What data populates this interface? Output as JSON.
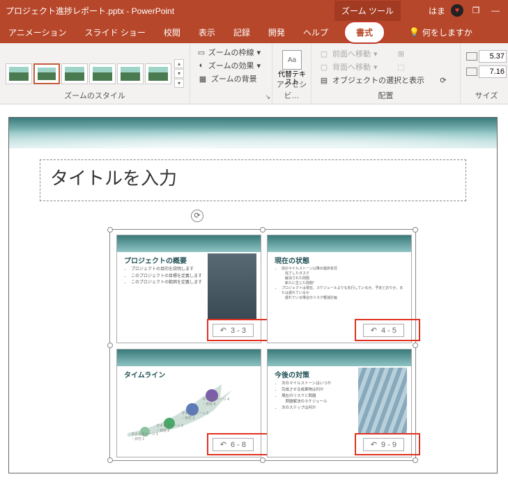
{
  "titlebar": {
    "document": "プロジェクト進捗レポート.pptx  -  PowerPoint",
    "tool_context": "ズーム ツール",
    "user": "はま",
    "maximize": "❐",
    "minimize": "—"
  },
  "tabs": {
    "animation": "アニメーション",
    "slideshow": "スライド ショー",
    "review": "校閲",
    "view": "表示",
    "record": "記録",
    "developer": "開発",
    "help": "ヘルプ",
    "format": "書式",
    "tellme": "何をしますか"
  },
  "ribbon": {
    "zoom_style": "ズームのスタイル",
    "zoom_border": "ズームの枠線",
    "zoom_effect": "ズームの効果",
    "zoom_bg": "ズームの背景",
    "alt_text": "代替テキスト",
    "access": "アクセシビ…",
    "bring_fwd": "前面へ移動",
    "send_back": "背面へ移動",
    "sel_pane": "オブジェクトの選択と表示",
    "arrange": "配置",
    "size": "サイズ",
    "height": "5.37",
    "width": "7.16"
  },
  "slide": {
    "title_placeholder": "タイトルを入力",
    "thumbs": [
      {
        "title": "プロジェクトの概要",
        "bullets": [
          "プロジェクトの目的を説明します",
          "このプロジェクトの目標を定義します",
          "このプロジェクトの範囲を定義します"
        ],
        "range": "3 - 3"
      },
      {
        "title": "現在の状態",
        "bullets": [
          "前のマイルストーン以降の進捗状況",
          "　完了したタスク",
          "　解決された問題",
          "　新たに生じた問題*",
          "プロジェクトは現在、スケジュールよりも先行しているか、予定どおりか、または遅れているか",
          "　遅れている場合のリスク軽減計画"
        ],
        "range": "4 - 5"
      },
      {
        "title": "タイムライン",
        "milestones": [
          "マイルストーン 1",
          "日付 1",
          "マイルストーン 2",
          "日付 2",
          "マイルストーン 3",
          "日付 3",
          "マイルストーン 4",
          "日付 4"
        ],
        "range": "6 - 8"
      },
      {
        "title": "今後の対策",
        "bullets": [
          "次のマイルストーンはいつか",
          "完成させる成果物は何か",
          "現在のリスクと問題",
          "　問題解決のスケジュール",
          "次のステップは何か"
        ],
        "range": "9 - 9"
      }
    ]
  }
}
